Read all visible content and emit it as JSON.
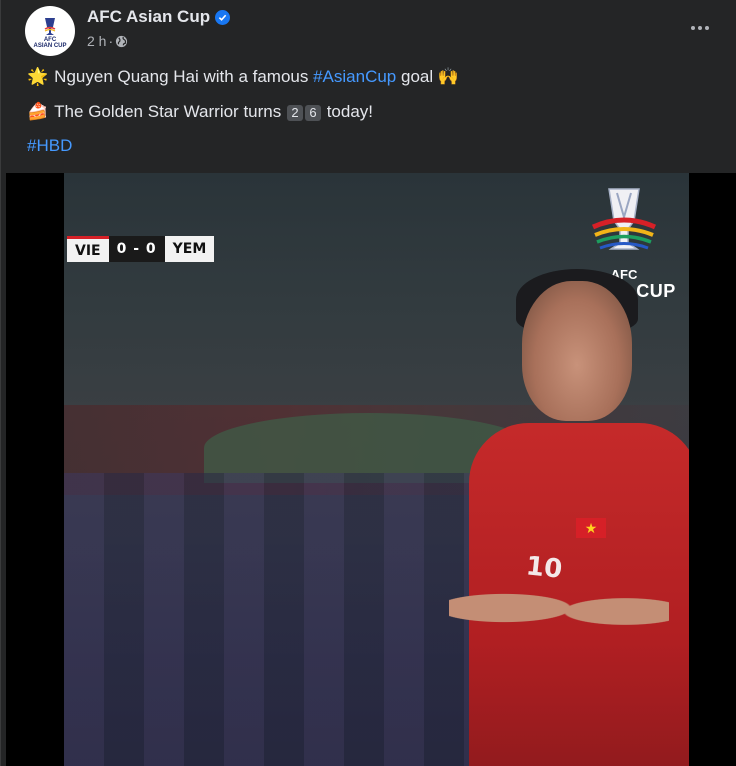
{
  "post": {
    "page_name": "AFC Asian Cup",
    "verified": true,
    "time": "2 h",
    "privacy_icon": "globe-icon",
    "more_icon": "more-dots-icon",
    "avatar": {
      "line1": "AFC",
      "line2": "ASIAN CUP"
    },
    "lines": [
      {
        "emoji": "🌟",
        "text_before": "Nguyen Quang Hai with a famous ",
        "hashtag": "#AsianCup",
        "text_after": " goal 🙌"
      },
      {
        "emoji": "🍰",
        "text_before": "The Golden Star Warrior turns ",
        "digits": [
          "2",
          "6"
        ],
        "text_after": " today!"
      }
    ],
    "tag_line": "#HBD"
  },
  "video": {
    "scoreboard": {
      "home": "VIE",
      "score": "0 - 0",
      "away": "YEM"
    },
    "logo": {
      "small": "AFC",
      "big": "ASIAN CUP"
    },
    "jersey_number": "10"
  },
  "colors": {
    "background": "#242526",
    "text": "#e4e6eb",
    "muted": "#b0b3b8",
    "link": "#4599ff",
    "verified": "#1877f2"
  }
}
